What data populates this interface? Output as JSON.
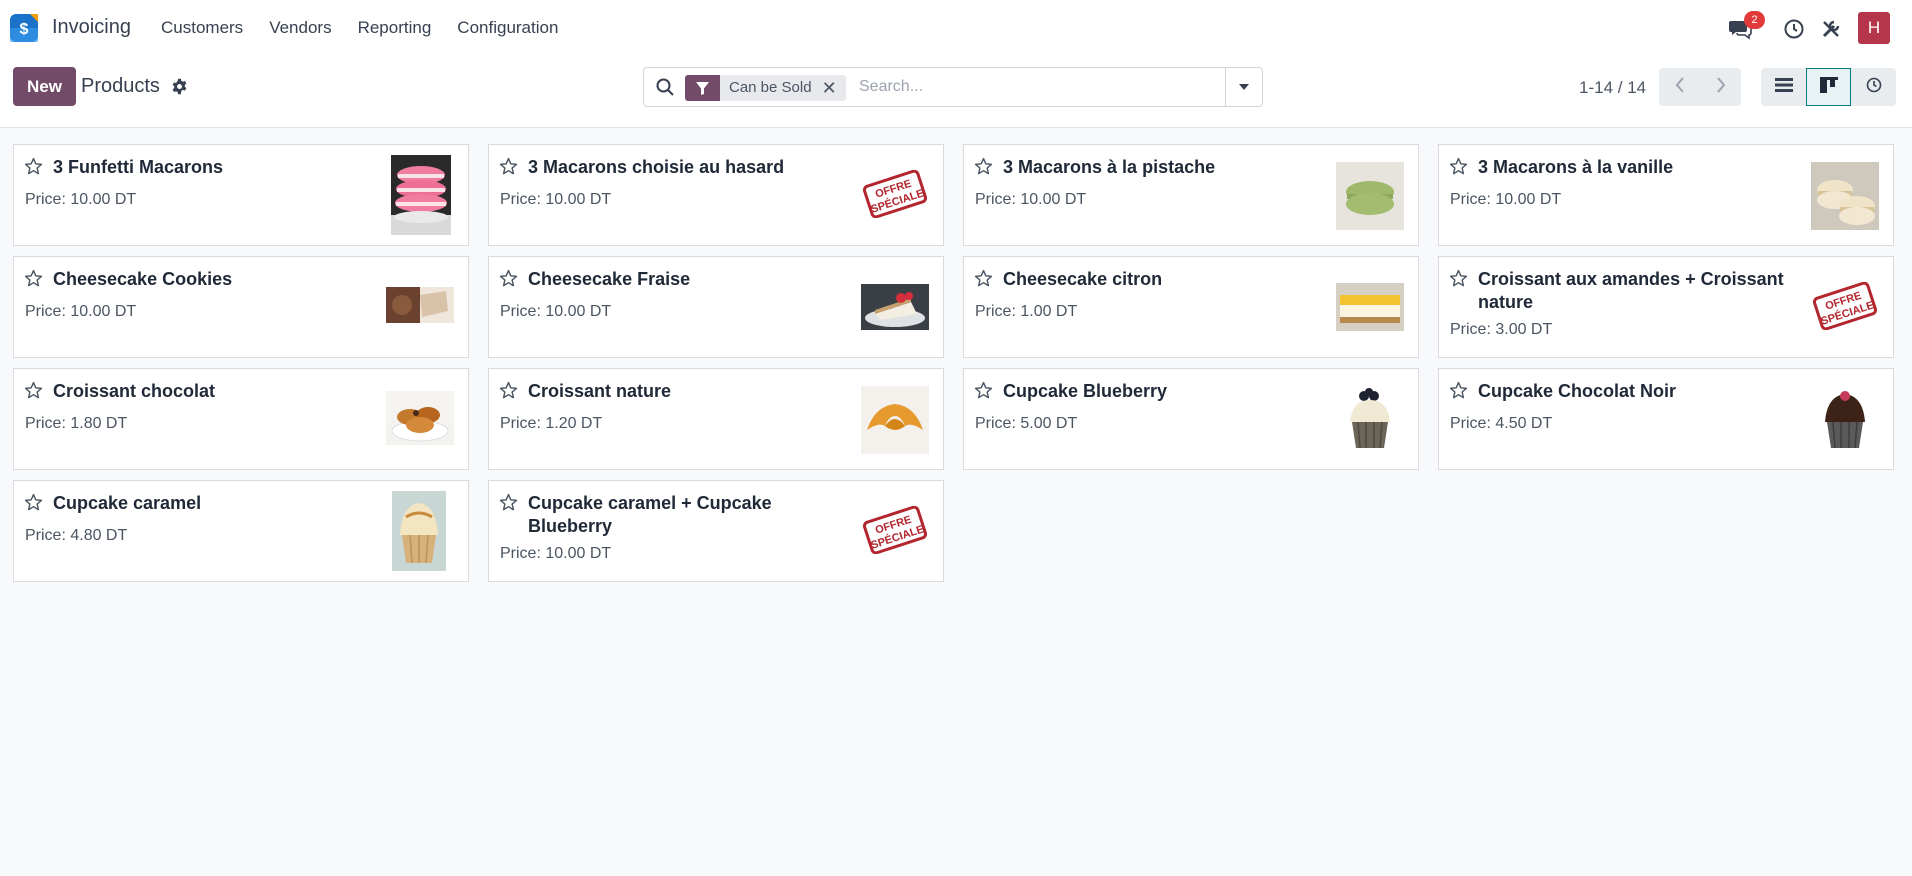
{
  "app": {
    "name": "Invoicing",
    "menu": [
      "Customers",
      "Vendors",
      "Reporting",
      "Configuration"
    ],
    "notifications_count": "2",
    "user_initial": "H"
  },
  "control": {
    "new_label": "New",
    "title": "Products",
    "facet_label": "Can be Sold",
    "search_placeholder": "Search...",
    "pager": "1-14 / 14"
  },
  "products": [
    {
      "name": "3 Funfetti Macarons",
      "price": "Price: 10.00 DT",
      "image": "pink-macarons"
    },
    {
      "name": "3 Macarons choisie au hasard",
      "price": "Price: 10.00 DT",
      "image": "offre-speciale-stamp"
    },
    {
      "name": "3 Macarons à la pistache",
      "price": "Price: 10.00 DT",
      "image": "pistachio-macaron"
    },
    {
      "name": "3 Macarons à la vanille",
      "price": "Price: 10.00 DT",
      "image": "vanilla-macarons"
    },
    {
      "name": "Cheesecake Cookies",
      "price": "Price: 10.00 DT",
      "image": "cheesecake-cookies"
    },
    {
      "name": "Cheesecake Fraise",
      "price": "Price: 10.00 DT",
      "image": "strawberry-cheesecake"
    },
    {
      "name": "Cheesecake citron",
      "price": "Price: 1.00 DT",
      "image": "lemon-cheesecake"
    },
    {
      "name": "Croissant aux amandes + Croissant nature",
      "price": "Price: 3.00 DT",
      "image": "offre-speciale-stamp"
    },
    {
      "name": "Croissant chocolat",
      "price": "Price: 1.80 DT",
      "image": "chocolate-croissants"
    },
    {
      "name": "Croissant nature",
      "price": "Price: 1.20 DT",
      "image": "croissant"
    },
    {
      "name": "Cupcake Blueberry",
      "price": "Price: 5.00 DT",
      "image": "blueberry-cupcake"
    },
    {
      "name": "Cupcake Chocolat Noir",
      "price": "Price: 4.50 DT",
      "image": "chocolate-cupcake"
    },
    {
      "name": "Cupcake caramel",
      "price": "Price: 4.80 DT",
      "image": "caramel-cupcake"
    },
    {
      "name": "Cupcake caramel + Cupcake Blueberry",
      "price": "Price: 10.00 DT",
      "image": "offre-speciale-stamp"
    }
  ],
  "colors": {
    "brand": "#714b67",
    "accent": "#017e84",
    "badge": "#e03a3a",
    "avatar": "#b5364a",
    "stamp": "#b3262e"
  }
}
